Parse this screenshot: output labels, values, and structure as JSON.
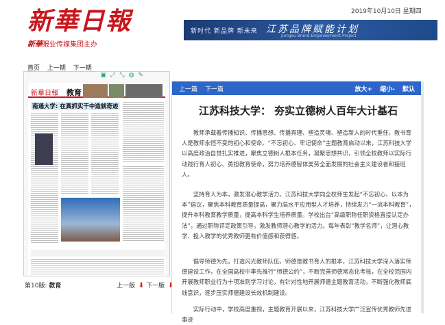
{
  "header": {
    "logo_text": "新華日報",
    "sub_brand": "新華",
    "sub_text": "报业传媒集团主办",
    "date": "2019年10月10日 星期四",
    "banner": {
      "tags": "新时代  新品牌  新未来",
      "title": "江苏品牌赋能计划",
      "subtitle": "Jiangsu Brand Empowerment Project"
    }
  },
  "nav": {
    "home": "首页",
    "prev_page": "上一期",
    "next_page": "下一期"
  },
  "thumbnail": {
    "paper_brand": "新華日報",
    "section": "教育",
    "headline": "南通大学: 在真抓实干中造就奇迹",
    "tools": [
      "copy-icon",
      "expand-icon",
      "shrink-icon",
      "wechat-icon",
      "share-icon"
    ]
  },
  "footer": {
    "page_label": "第10版:",
    "page_name": "教育",
    "prev_version": "上一版",
    "next_version": "下一版"
  },
  "article": {
    "bar": {
      "prev": "上一篇",
      "next": "下一篇",
      "zoom_in": "放大+",
      "zoom_out": "缩小-",
      "default": "默认"
    },
    "title": "江苏科技大学：  夯实立德树人百年大计基石",
    "paragraphs": [
      "教师承载着传播知识、传播思想、传播真理、塑造灵魂、塑造新人的时代重任，教书育人是教师永恒不变的初心和使命。“不忘初心、牢记使命”主题教育启动以来，江苏科技大学以高度政治自觉扎实推进，聚焦立德树人根本任务，凝聚思想共识，引领全校教师以实际行动践行育人初心、勇担教育使命，努力培养德智体美劳全面发展的社会主义建设者和接班人。",
      "坚持育人为本，激发潜心教学活力。江苏科技大学向全校师生发起“不忘初心、以本为本”倡议，聚焦本科教育质量提高，聚力高水平应用型人才培养，持续发力“一流本科教育”，提升本科教育教学质量，提高本科学生培养质量。学校出台“高级职称任职资格直接认定办法”，通过职称评定政策引导，激发教师潜心教学的活力。每年表彰“教学名师”，让潜心教学、投入教学的优秀教师更有价值感和获得感。",
      "倡导师德为先，打造闪光教师队伍。师德是教书育人的根本，江苏科技大学深入落实师德建设工作，在全国高校中率先推行“师德公约”，不断完善师德常态化考核，在全校范围内开展教师职业行为十项准则学习讨论，有针对性地开展师德主题教育活动，不断强化教师底线意识，逐步压实师德建设长效机制建设。",
      "实际行动中，学校高度重视，主题教育开展以来，江苏科技大学广泛宣传优秀教师先进事迹"
    ]
  }
}
